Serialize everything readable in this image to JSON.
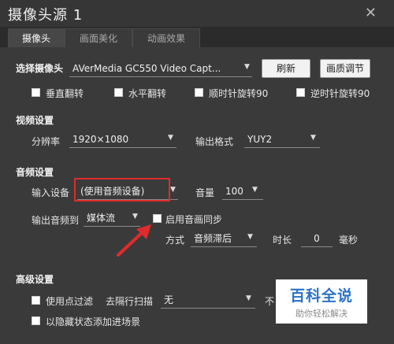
{
  "window": {
    "title": "摄像头源 1",
    "close_icon": "close-icon"
  },
  "tabs": [
    {
      "label": "摄像头"
    },
    {
      "label": "画面美化"
    },
    {
      "label": "动画效果"
    }
  ],
  "camera": {
    "select_label": "选择摄像头",
    "device": "AVerMedia GC550 Video Capt...",
    "refresh_button": "刷新",
    "quality_button": "画质调节",
    "options": [
      "垂直翻转",
      "水平翻转",
      "顺时针旋转90",
      "逆时针旋转90"
    ]
  },
  "video": {
    "header": "视频设置",
    "resolution_label": "分辨率",
    "resolution": "1920×1080",
    "format_label": "输出格式",
    "format": "YUY2"
  },
  "audio": {
    "header": "音频设置",
    "input_label": "输入设备",
    "input_device": "(使用音频设备)",
    "volume_label": "音量",
    "volume": "100",
    "output_label": "输出音频到",
    "output_target": "媒体流",
    "sync_label": "启用音画同步",
    "mode_label": "方式",
    "mode": "音频滞后",
    "duration_label": "时长",
    "duration": "0",
    "unit": "毫秒"
  },
  "advanced": {
    "header": "高级设置",
    "point_filter": "使用点过滤",
    "deinterlace_label": "去隔行扫描",
    "deinterlace": "无",
    "hidden_add": "以隐藏状态添加进场景",
    "truncated": "不"
  },
  "watermark": {
    "line1": "百科全说",
    "line2": "助你轻松解决"
  },
  "colors": {
    "annotation_red": "#e12b2b",
    "panel_bg": "#3a3a3a",
    "title_bg": "#363636"
  }
}
